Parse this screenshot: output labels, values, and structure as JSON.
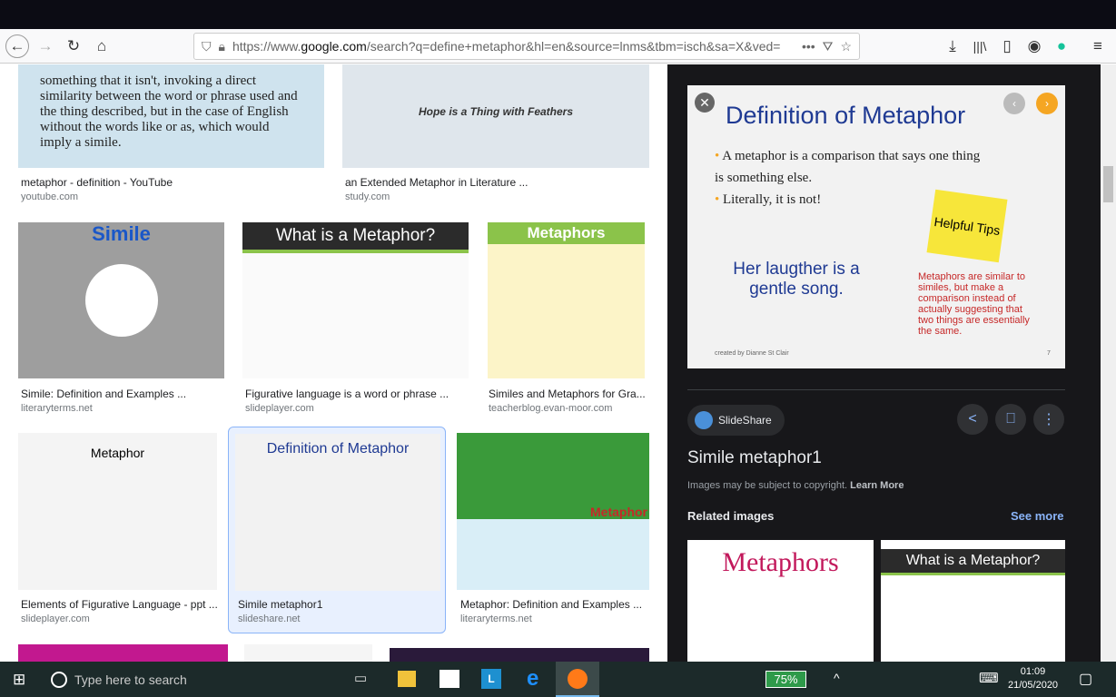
{
  "browser": {
    "url_prefix": "https://www.",
    "url_domain": "google.com",
    "url_rest": "/search?q=define+metaphor&hl=en&source=lnms&tbm=isch&sa=X&ved=",
    "more": "•••"
  },
  "results": [
    {
      "caption": "metaphor - definition - YouTube",
      "source": "youtube.com",
      "thumb_text": "something that it isn't, invoking a direct similarity between the word or phrase used and the thing described, but in the case of English without the words like or as, which would imply a simile."
    },
    {
      "caption": "an Extended Metaphor in Literature ...",
      "source": "study.com",
      "thumb_text": "Hope is a Thing with Feathers"
    },
    {
      "caption": "Simile: Definition and Examples ...",
      "source": "literaryterms.net",
      "thumb_text": "Simile"
    },
    {
      "caption": "Figurative language is a word or phrase ...",
      "source": "slideplayer.com",
      "thumb_text": "What is a Metaphor?"
    },
    {
      "caption": "Similes and Metaphors for Gra...",
      "source": "teacherblog.evan-moor.com",
      "thumb_text": "Metaphors"
    },
    {
      "caption": "Elements of Figurative Language - ppt ...",
      "source": "slideplayer.com",
      "thumb_text": "Metaphor"
    },
    {
      "caption": "Simile metaphor1",
      "source": "slideshare.net",
      "thumb_text": "Definition of Metaphor"
    },
    {
      "caption": "Metaphor: Definition and Examples ...",
      "source": "literaryterms.net",
      "thumb_text": "Metaphor"
    }
  ],
  "panel": {
    "preview": {
      "heading": "Definition of Metaphor",
      "bullets": [
        "A metaphor is a comparison that says one thing is something else.",
        "Literally, it is not!"
      ],
      "song": "Her laugther is a gentle song.",
      "note": "Helpful Tips",
      "side": "Metaphors are similar to similes, but make a comparison instead of actually suggesting that two things are essentially the same.",
      "credit": "created by Dianne St Clair",
      "page": "7"
    },
    "source_chip": "SlideShare",
    "title": "Simile metaphor1",
    "copyright": "Images may be subject to copyright.",
    "learn_more": "Learn More",
    "related": "Related images",
    "see_more": "See more",
    "related_thumbs": [
      "Metaphors",
      "What is a Metaphor?"
    ]
  },
  "taskbar": {
    "search_placeholder": "Type here to search",
    "battery": "75%",
    "time": "01:09",
    "date": "21/05/2020"
  }
}
